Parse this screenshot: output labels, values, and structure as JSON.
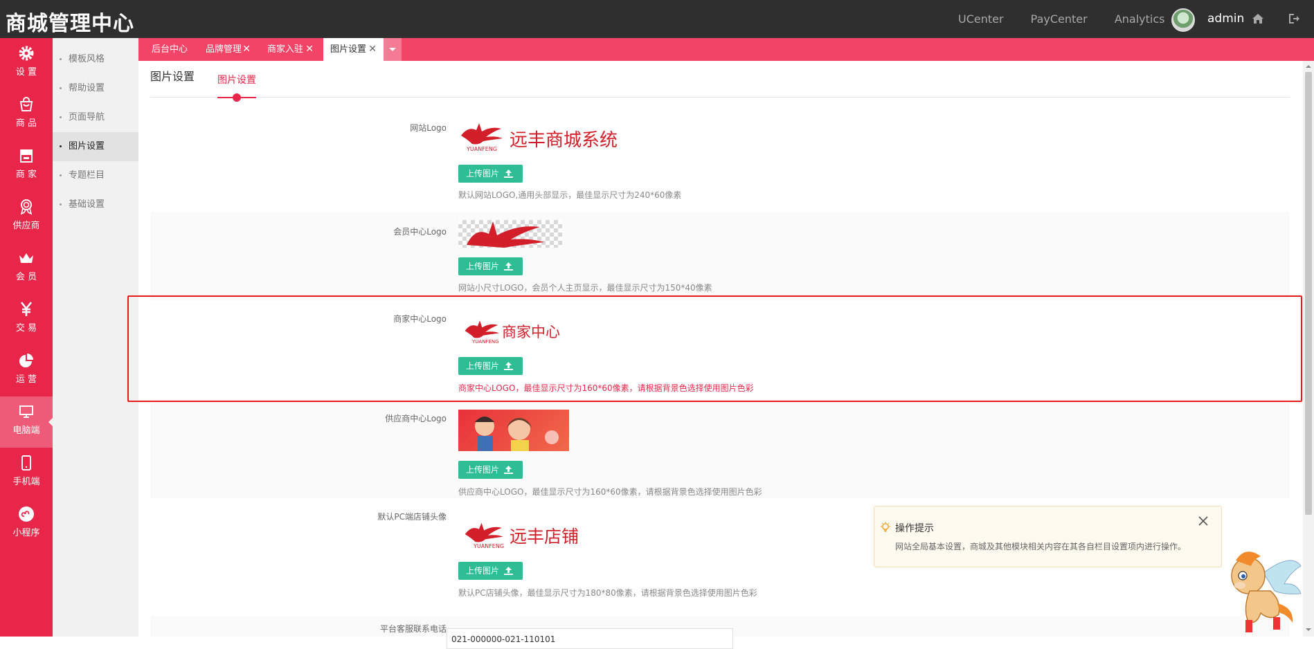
{
  "app": {
    "title": "商城管理中心"
  },
  "top_links": [
    "UCenter",
    "PayCenter",
    "Analytics"
  ],
  "user": {
    "name": "admin"
  },
  "nav": [
    {
      "label": "设 置",
      "icon": "gear-icon"
    },
    {
      "label": "商 品",
      "icon": "bag-icon"
    },
    {
      "label": "商 家",
      "icon": "store-icon"
    },
    {
      "label": "供应商",
      "icon": "medal-icon"
    },
    {
      "label": "会 员",
      "icon": "crown-icon"
    },
    {
      "label": "交 易",
      "icon": "yen-icon"
    },
    {
      "label": "运 营",
      "icon": "pie-icon"
    },
    {
      "label": "电脑端",
      "icon": "monitor-icon",
      "active": true
    },
    {
      "label": "手机端",
      "icon": "phone-icon"
    },
    {
      "label": "小程序",
      "icon": "miniprogram-icon"
    }
  ],
  "subnav": [
    "模板风格",
    "帮助设置",
    "页面导航",
    "图片设置",
    "专题栏目",
    "基础设置"
  ],
  "subnav_active": "图片设置",
  "tabs": [
    {
      "label": "后台中心",
      "closable": false
    },
    {
      "label": "品牌管理",
      "closable": true
    },
    {
      "label": "商家入驻",
      "closable": true
    },
    {
      "label": "图片设置",
      "closable": true,
      "active": true
    }
  ],
  "page": {
    "title": "图片设置",
    "subtab": "图片设置"
  },
  "fields": [
    {
      "label": "网站Logo",
      "logo_text": "远丰商城系统",
      "logo_sub": "YUANFENG",
      "button": "上传图片",
      "hint": "默认网站LOGO,通用头部显示，最佳显示尺寸为240*60像素"
    },
    {
      "label": "会员中心Logo",
      "button": "上传图片",
      "hint": "网站小尺寸LOGO，会员个人主页显示，最佳显示尺寸为150*40像素"
    },
    {
      "label": "商家中心Logo",
      "logo_text": "商家中心",
      "logo_sub": "YUANFENG",
      "button": "上传图片",
      "hint": "商家中心LOGO，最佳显示尺寸为160*60像素，请根据背景色选择使用图片色彩"
    },
    {
      "label": "供应商中心Logo",
      "button": "上传图片",
      "hint": "供应商中心LOGO，最佳显示尺寸为160*60像素，请根据背景色选择使用图片色彩"
    },
    {
      "label": "默认PC端店铺头像",
      "logo_text": "远丰店铺",
      "logo_sub": "YUANFENG",
      "button": "上传图片",
      "hint": "默认PC店铺头像，最佳显示尺寸为180*80像素，请根据背景色选择使用图片色彩"
    },
    {
      "label": "平台客服联系电话",
      "value": "021-000000-021-110101"
    }
  ],
  "tip": {
    "title": "操作提示",
    "text": "网站全局基本设置，商城及其他模块相关内容在其各自栏目设置项内进行操作。"
  },
  "colors": {
    "brand": "#e8264a",
    "topbar": "#2f2f2f",
    "upload": "#2ebd95",
    "tabbar": "#f24467"
  }
}
